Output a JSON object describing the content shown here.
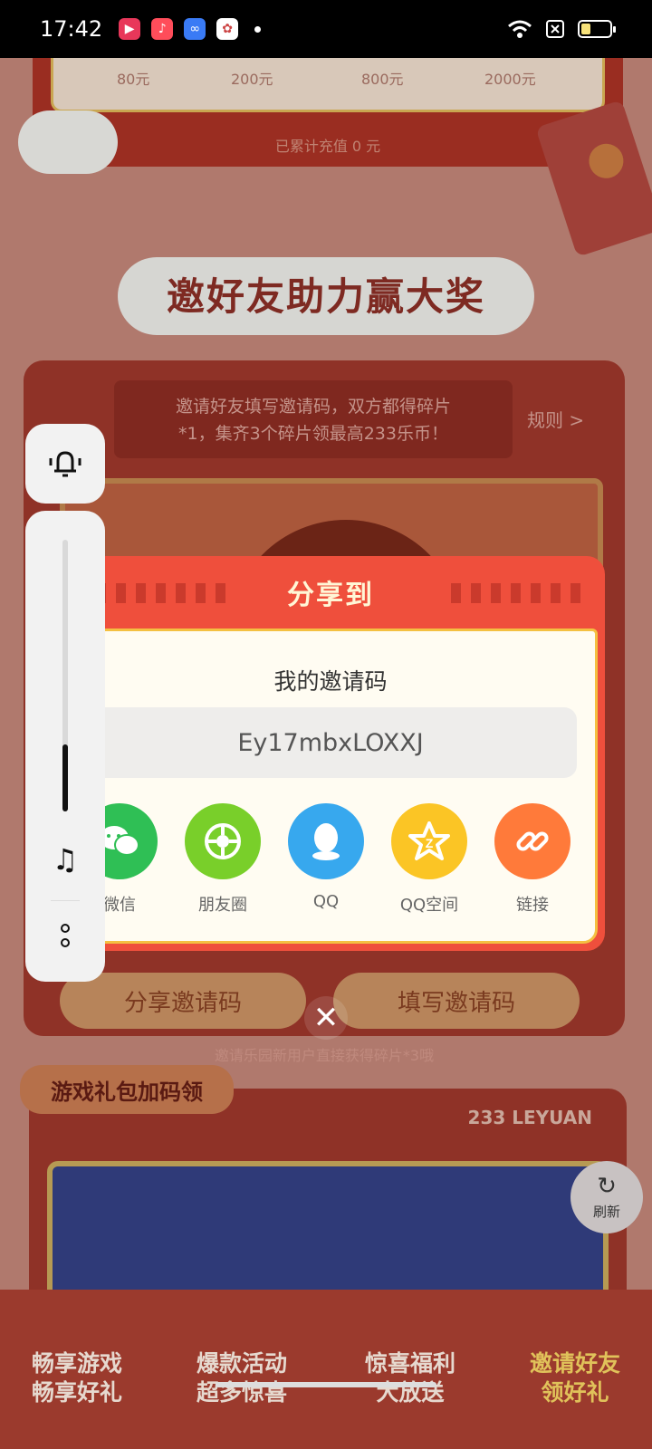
{
  "status_bar": {
    "time": "17:42",
    "app_icons": [
      {
        "name": "video-app-icon",
        "color": "#e8375a",
        "glyph": "▶"
      },
      {
        "name": "music-app-icon",
        "color": "#ff4d5a",
        "glyph": "♪"
      },
      {
        "name": "infinity-app-icon",
        "color": "#3a7bf5",
        "glyph": "∞"
      },
      {
        "name": "game-app-icon",
        "color": "#ffffff",
        "glyph": "✿"
      }
    ]
  },
  "background": {
    "recharge_tiers": [
      "80元",
      "200元",
      "800元",
      "2000元"
    ],
    "recharged_total": "已累计充值 0 元",
    "section_title": "邀好友助力赢大奖",
    "rule_text_line1": "邀请好友填写邀请码，双方都得碎片",
    "rule_text_line2": "*1，集齐3个碎片领最高233乐币！",
    "rule_link": "规则 >",
    "share_code_button": "分享邀请码",
    "fill_code_button": "填写邀请码",
    "invite_hint": "邀请乐园新用户直接获得碎片*3哦",
    "gift_section_title": "游戏礼包加码领",
    "leyuan_label": "233 LEYUAN",
    "refresh_label": "刷新",
    "bottom_nav": [
      {
        "line1": "畅享游戏",
        "line2": "畅享好礼"
      },
      {
        "line1": "爆款活动",
        "line2": "超多惊喜"
      },
      {
        "line1": "惊喜福利",
        "line2": "大放送"
      },
      {
        "line1": "邀请好友",
        "line2": "领好礼"
      }
    ]
  },
  "share_modal": {
    "header": "分享到",
    "invite_code_label": "我的邀请码",
    "invite_code": "Ey17mbxLOXXJ",
    "targets": [
      {
        "label": "微信",
        "icon": "wechat-icon",
        "color": "#2fbf55"
      },
      {
        "label": "朋友圈",
        "icon": "moments-icon",
        "color": "#79cf2a"
      },
      {
        "label": "QQ",
        "icon": "qq-icon",
        "color": "#37a8ee"
      },
      {
        "label": "QQ空间",
        "icon": "qzone-icon",
        "color": "#fbc525"
      },
      {
        "label": "链接",
        "icon": "link-icon",
        "color": "#ff7a3a"
      }
    ],
    "close_icon": "close-icon"
  },
  "volume_overlay": {
    "bell_icon": "bell-icon",
    "music_icon": "music-note-icon",
    "more_icon": "more-icon",
    "volume_level": 0.25
  }
}
